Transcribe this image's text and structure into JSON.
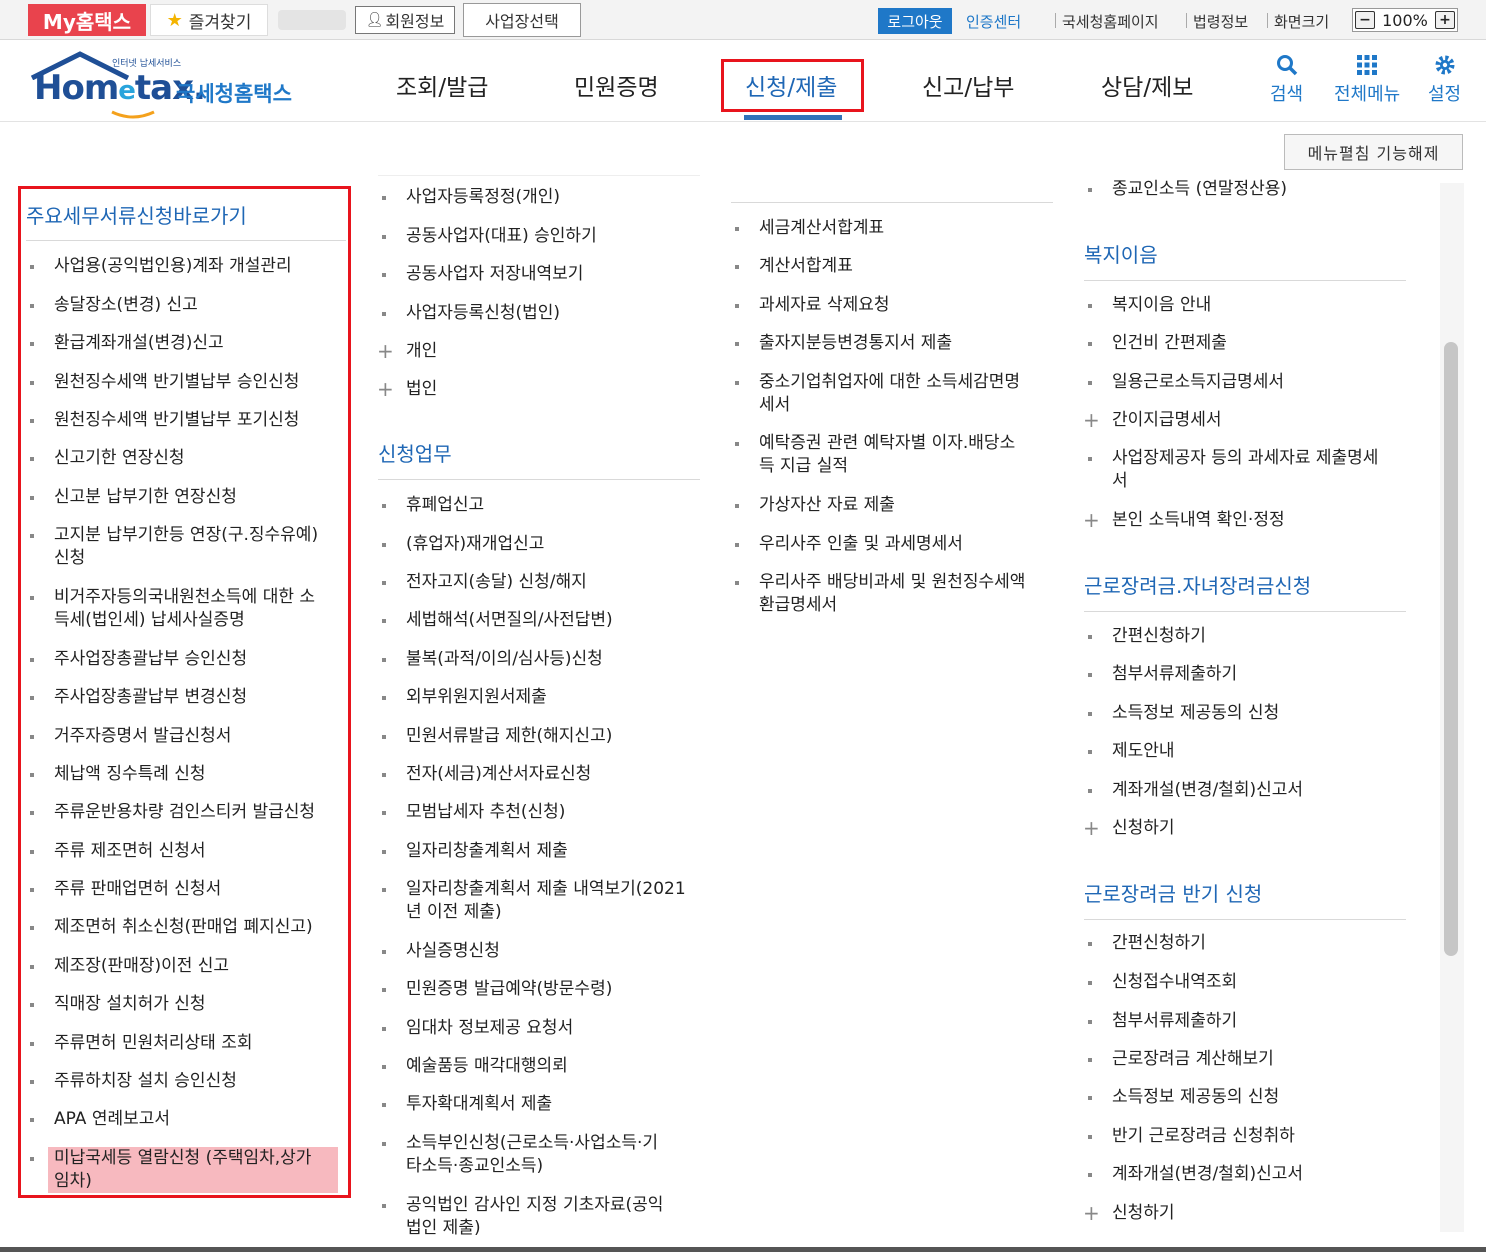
{
  "topbar": {
    "my_hometax": "My홈택스",
    "favorites": "즐겨찾기",
    "member_info": "회원정보",
    "business_select": "사업장선택",
    "logout": "로그아웃",
    "cert_center": "인증센터",
    "nts_homepage": "국세청홈페이지",
    "law_info": "법령정보",
    "screen_size": "화면크기",
    "zoom_level": "100%",
    "zoom_minus": "−",
    "zoom_plus": "+"
  },
  "header": {
    "logo_tagline": "인터넷 납세서비스",
    "logo_home_a": "Hom",
    "logo_home_e": "e",
    "logo_home_b": "tax.",
    "logo_korean": "국세청홈택스",
    "nav": [
      "조회/발급",
      "민원증명",
      "신청/제출",
      "신고/납부",
      "상담/제보"
    ],
    "active_nav": "신청/제출",
    "search": "검색",
    "all_menu": "전체메뉴",
    "settings": "설정"
  },
  "collapse_button": "메뉴펼침 기능해제",
  "col1": {
    "title": "주요세무서류신청바로가기",
    "items": [
      "사업용(공익법인용)계좌 개설관리",
      "송달장소(변경) 신고",
      "환급계좌개설(변경)신고",
      "원천징수세액 반기별납부 승인신청",
      "원천징수세액 반기별납부 포기신청",
      "신고기한 연장신청",
      "신고분 납부기한 연장신청",
      "고지분 납부기한등 연장(구.징수유예)",
      "신청",
      "비거주자등의국내원천소득에 대한 소",
      "득세(법인세) 납세사실증명",
      "주사업장총괄납부 승인신청",
      "주사업장총괄납부 변경신청",
      "거주자증명서 발급신청서",
      "체납액 징수특례 신청",
      "주류운반용차량 검인스티커 발급신청",
      "주류 제조면허 신청서",
      "주류 판매업면허 신청서",
      "제조면허 취소신청(판매업 폐지신고)",
      "제조장(판매장)이전 신고",
      "직매장 설치허가 신청",
      "주류면허 민원처리상태 조회",
      "주류하치장 설치 승인신청",
      "APA 연례보고서",
      "미납국세등 열람신청 (주택임차,상가",
      "임차)"
    ]
  },
  "col2": {
    "items_top": [
      "사업자등록정정(개인)",
      "공동사업자(대표) 승인하기",
      "공동사업자 저장내역보기",
      "사업자등록신청(법인)",
      "개인",
      "법인"
    ],
    "section_title": "신청업무",
    "items": [
      "휴폐업신고",
      "(휴업자)재개업신고",
      "전자고지(송달) 신청/해지",
      "세법해석(서면질의/사전답변)",
      "불복(과적/이의/심사등)신청",
      "외부위원지원서제출",
      "민원서류발급 제한(해지신고)",
      "전자(세금)계산서자료신청",
      "모범납세자 추천(신청)",
      "일자리창출계획서 제출",
      "일자리창출계획서 제출 내역보기(2021",
      "년 이전 제출)",
      "사실증명신청",
      "민원증명 발급예약(방문수령)",
      "임대차 정보제공 요청서",
      "예술품등 매각대행의뢰",
      "투자확대계획서 제출",
      "소득부인신청(근로소득·사업소득·기",
      "타소득·종교인소득)",
      "공익법인 감사인 지정 기초자료(공익",
      "법인 제출)"
    ]
  },
  "col3": {
    "items": [
      "세금계산서합계표",
      "계산서합계표",
      "과세자료 삭제요청",
      "출자지분등변경통지서 제출",
      "중소기업취업자에 대한 소득세감면명",
      "세서",
      "예탁증권 관련 예탁자별 이자.배당소",
      "득 지급 실적",
      "가상자산 자료 제출",
      "우리사주 인출 및 과세명세서",
      "우리사주 배당비과세 및 원천징수세액",
      "환급명세서"
    ]
  },
  "col4": {
    "item_top": "종교인소득 (연말정산용)",
    "sec1_title": "복지이음",
    "sec1_items": [
      "복지이음 안내",
      "인건비 간편제출",
      "일용근로소득지급명세서",
      "간이지급명세서",
      "사업장제공자 등의 과세자료 제출명세",
      "서",
      "본인 소득내역 확인·정정"
    ],
    "sec2_title": "근로장려금.자녀장려금신청",
    "sec2_items": [
      "간편신청하기",
      "첨부서류제출하기",
      "소득정보 제공동의 신청",
      "제도안내",
      "계좌개설(변경/철회)신고서",
      "신청하기"
    ],
    "sec3_title": "근로장려금 반기 신청",
    "sec3_items": [
      "간편신청하기",
      "신청접수내역조회",
      "첨부서류제출하기",
      "근로장려금 계산해보기",
      "소득정보 제공동의 신청",
      "반기 근로장려금 신청취하",
      "계좌개설(변경/철회)신고서",
      "신청하기"
    ]
  },
  "colors": {
    "accent": "#1f67b5",
    "highlight_box": "#e8141d",
    "highlight_fill": "#f7b9bf"
  }
}
